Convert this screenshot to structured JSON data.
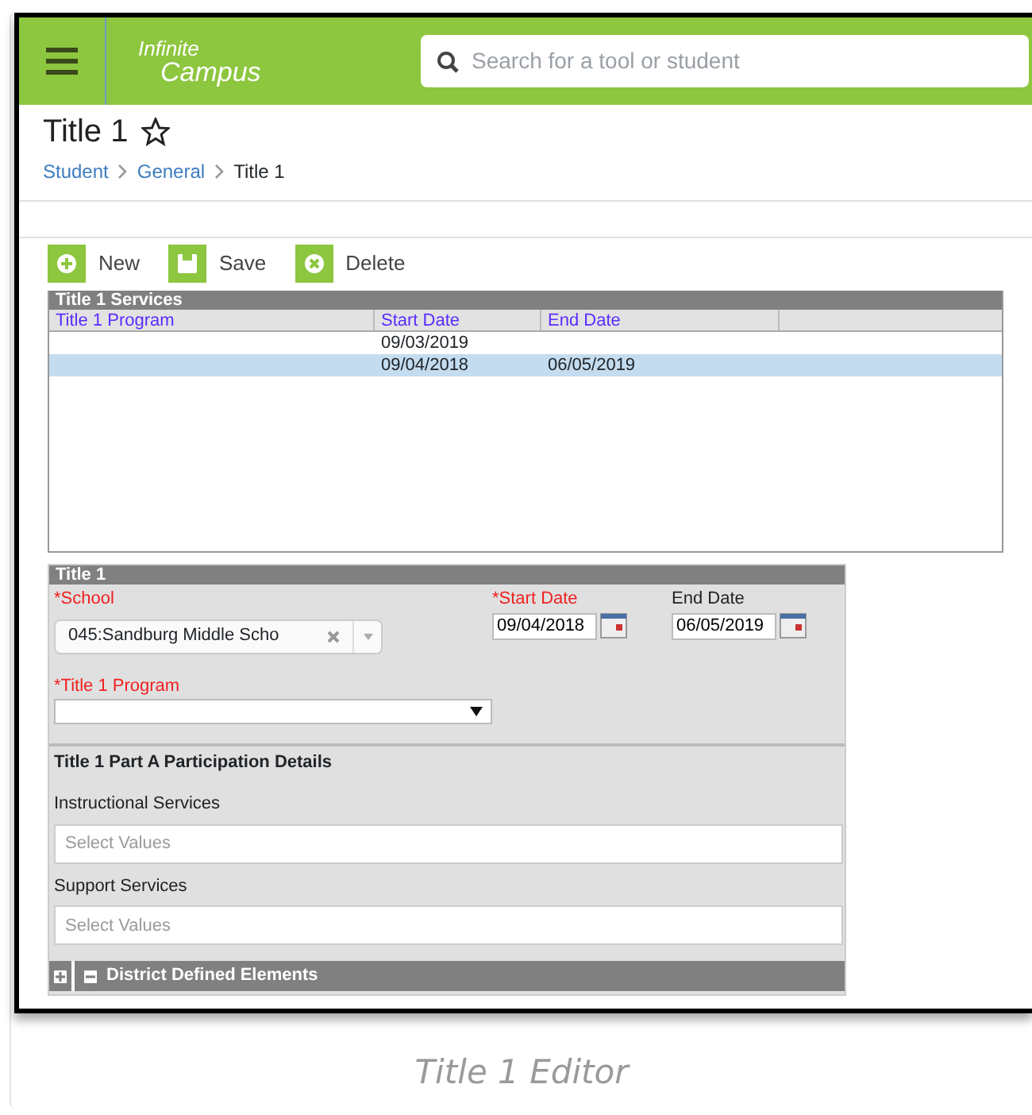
{
  "header": {
    "logo_line1": "Infinite",
    "logo_line2": "Campus",
    "search": {
      "placeholder": "Search for a tool or student"
    }
  },
  "page": {
    "title": "Title 1",
    "favorite": false,
    "breadcrumbs": [
      {
        "label": "Student",
        "link": true
      },
      {
        "label": "General",
        "link": true
      },
      {
        "label": "Title 1",
        "link": false
      }
    ]
  },
  "toolbar": [
    {
      "label": "New",
      "kind": "new"
    },
    {
      "label": "Save",
      "kind": "save"
    },
    {
      "label": "Delete",
      "kind": "delete"
    }
  ],
  "services": {
    "title": "Title 1 Services",
    "columns": [
      "Title 1 Program",
      "Start Date",
      "End Date"
    ],
    "rows": [
      {
        "cells": [
          "",
          "09/03/2019",
          ""
        ],
        "selected": false
      },
      {
        "cells": [
          "",
          "09/04/2018",
          "06/05/2019"
        ],
        "selected": true
      }
    ]
  },
  "editor": {
    "title": "Title 1",
    "school": {
      "label": "*School",
      "value": "045:Sandburg Middle Scho",
      "required": true
    },
    "start_date": {
      "label": "*Start Date",
      "value": "09/04/2018",
      "required": true
    },
    "end_date": {
      "label": "End Date",
      "value": "06/05/2019",
      "required": false
    },
    "program": {
      "label": "*Title 1 Program",
      "required": true
    },
    "section": "Title 1 Part A Participation Details",
    "multi": [
      {
        "label": "Instructional Services",
        "placeholder": "Select Values"
      },
      {
        "label": "Support Services",
        "placeholder": "Select Values"
      }
    ],
    "footer": "District Defined Elements"
  },
  "caption": "Title 1 Editor"
}
